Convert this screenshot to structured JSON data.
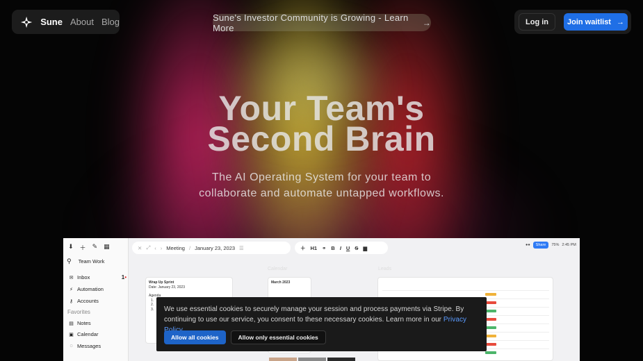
{
  "nav": {
    "brand": "Sune",
    "links": [
      "About",
      "Blog"
    ],
    "login_label": "Log in",
    "join_label": "Join waitlist"
  },
  "announcement": {
    "text": "Sune's Investor Community is Growing - Learn More",
    "arrow": "→"
  },
  "hero": {
    "title_line1": "Your Team's",
    "title_line2": "Second Brain",
    "subtitle_line1": "The AI Operating System for your team to",
    "subtitle_line2": "collaborate and automate untapped workflows."
  },
  "app_preview": {
    "workspace": "Team Work",
    "sidebar": {
      "items": [
        {
          "label": "Inbox",
          "badge": "1"
        },
        {
          "label": "Automation"
        },
        {
          "label": "Accounts"
        }
      ],
      "favorites_label": "Favorites",
      "favorites": [
        {
          "label": "Notes"
        },
        {
          "label": "Calendar"
        },
        {
          "label": "Messages"
        }
      ]
    },
    "toolbar": {
      "crumb1": "Meeting",
      "crumb2": "January 23, 2023",
      "format_heading": "H1",
      "format_items": [
        "B",
        "I",
        "U",
        "S"
      ]
    },
    "top_right": {
      "share": "Share",
      "zoom": "75%",
      "time": "2:45 PM"
    },
    "card1": {
      "title": "Wrap Up Sprint",
      "date": "Date: January 23, 2023",
      "agenda": "Agenda",
      "items": [
        "1.",
        "2.",
        "3."
      ]
    },
    "card2": {
      "title": "March 2023"
    },
    "faint_labels": [
      "Calendar",
      "Leads"
    ]
  },
  "cookie": {
    "text": "We use essential cookies to securely manage your session and process payments via Stripe. By continuing to use our service, you consent to these necessary cookies. Learn more in our",
    "link": "Privacy Policy",
    "period": ".",
    "allow_all": "Allow all cookies",
    "allow_essential": "Allow only essential cookies"
  },
  "colors": {
    "accent": "#1f6fe6",
    "cookie_link": "#5b9bff"
  }
}
